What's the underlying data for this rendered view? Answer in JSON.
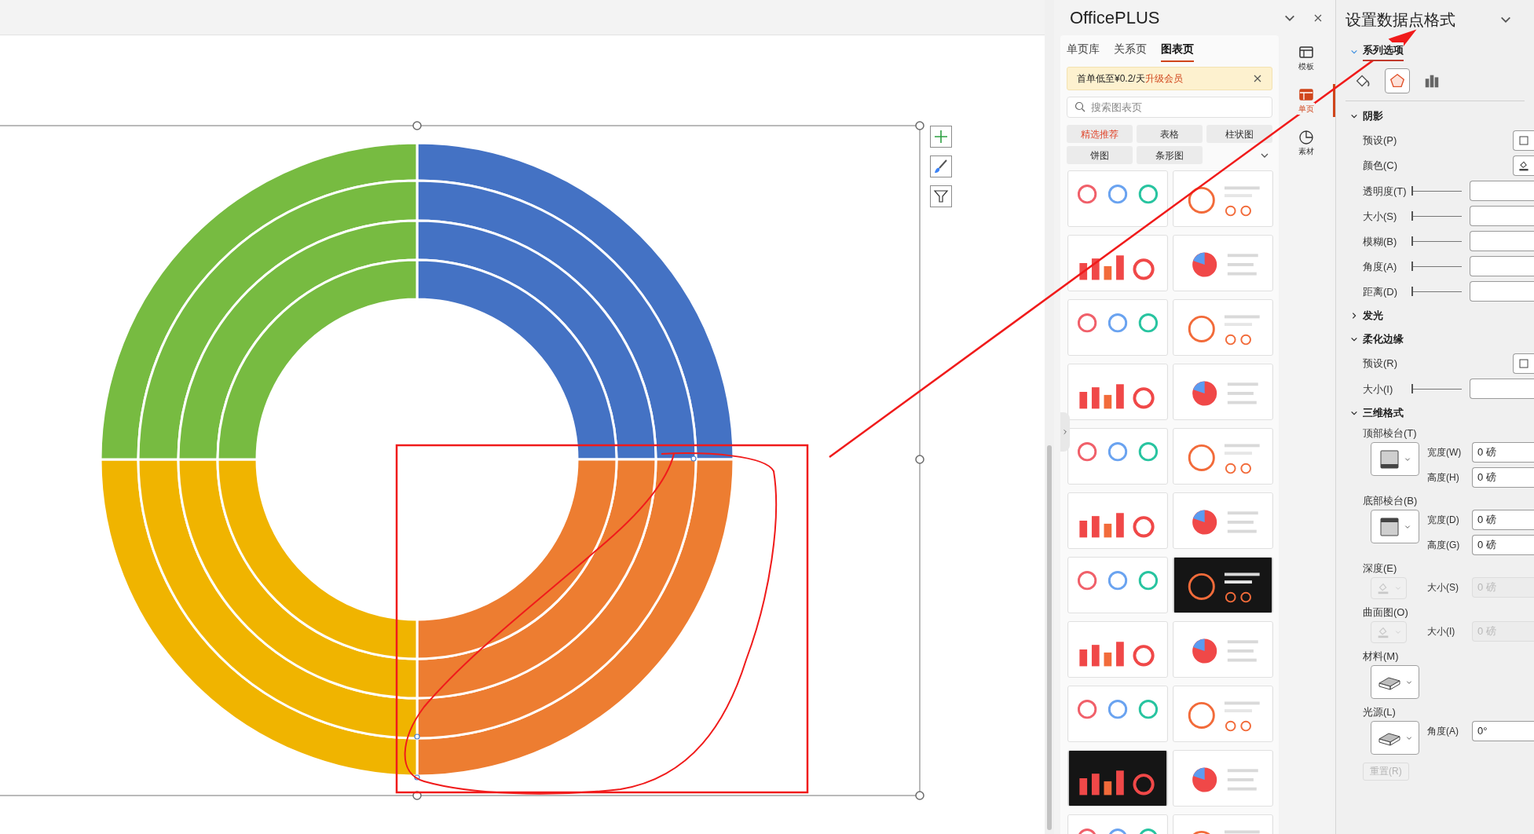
{
  "officeplus": {
    "title": "OfficePLUS",
    "tabs": [
      {
        "label": "单页库",
        "selected": false
      },
      {
        "label": "关系页",
        "selected": false
      },
      {
        "label": "图表页",
        "selected": true
      }
    ],
    "promo": {
      "text": "首单低至¥0.2/天",
      "link": "升级会员"
    },
    "search": {
      "placeholder": "搜索图表页"
    },
    "categories": [
      {
        "label": "精选推荐",
        "selected": true
      },
      {
        "label": "表格",
        "selected": false
      },
      {
        "label": "柱状图",
        "selected": false
      },
      {
        "label": "饼图",
        "selected": false
      },
      {
        "label": "条形图",
        "selected": false
      }
    ]
  },
  "side_nav": [
    {
      "label": "模板",
      "selected": false
    },
    {
      "label": "单页",
      "selected": true
    },
    {
      "label": "素材",
      "selected": false
    }
  ],
  "format_pane": {
    "title": "设置数据点格式",
    "section_tab": "系列选项",
    "option_tabs": [
      {
        "kind": "fill",
        "selected": false
      },
      {
        "kind": "effects",
        "selected": true
      },
      {
        "kind": "series",
        "selected": false
      }
    ],
    "groups": [
      {
        "title": "阴影",
        "expanded": true,
        "rows": [
          {
            "kind": "preset",
            "label": "预设(P)"
          },
          {
            "kind": "color",
            "label": "颜色(C)"
          },
          {
            "kind": "slider",
            "label": "透明度(T)",
            "level": 0
          },
          {
            "kind": "slider",
            "label": "大小(S)",
            "level": 0
          },
          {
            "kind": "slider",
            "label": "模糊(B)",
            "level": 0
          },
          {
            "kind": "slider",
            "label": "角度(A)",
            "level": 0
          },
          {
            "kind": "slider",
            "label": "距离(D)",
            "level": 0
          }
        ]
      },
      {
        "title": "发光",
        "expanded": false
      },
      {
        "title": "柔化边缘",
        "expanded": true,
        "rows": [
          {
            "kind": "preset",
            "label": "预设(R)"
          },
          {
            "kind": "slider",
            "label": "大小(I)",
            "level": 0
          }
        ]
      },
      {
        "title": "三维格式",
        "expanded": true,
        "rows": [
          {
            "kind": "bevel_top",
            "label": "顶部棱台(T)",
            "disabled": false,
            "fields": [
              {
                "label": "宽度(W)",
                "value": "0 磅",
                "disabled": false
              },
              {
                "label": "高度(H)",
                "value": "0 磅",
                "disabled": false
              }
            ]
          },
          {
            "kind": "bevel_bottom",
            "label": "底部棱台(B)",
            "disabled": false,
            "fields": [
              {
                "label": "宽度(D)",
                "value": "0 磅",
                "disabled": false
              },
              {
                "label": "高度(G)",
                "value": "0 磅",
                "disabled": false
              }
            ]
          },
          {
            "kind": "depth",
            "label": "深度(E)",
            "disabled": true,
            "fields": [
              {
                "label": "大小(S)",
                "value": "0 磅",
                "disabled": true
              }
            ]
          },
          {
            "kind": "contour",
            "label": "曲面图(O)",
            "disabled": true,
            "fields": [
              {
                "label": "大小(I)",
                "value": "0 磅",
                "disabled": true
              }
            ]
          },
          {
            "kind": "material",
            "label": "材料(M)",
            "disabled": false
          },
          {
            "kind": "lighting",
            "label": "光源(L)",
            "disabled": false,
            "fields": [
              {
                "label": "角度(A)",
                "value": "0°",
                "disabled": false
              }
            ]
          }
        ]
      }
    ],
    "reset": {
      "label": "重置(R)",
      "disabled": true
    }
  }
}
